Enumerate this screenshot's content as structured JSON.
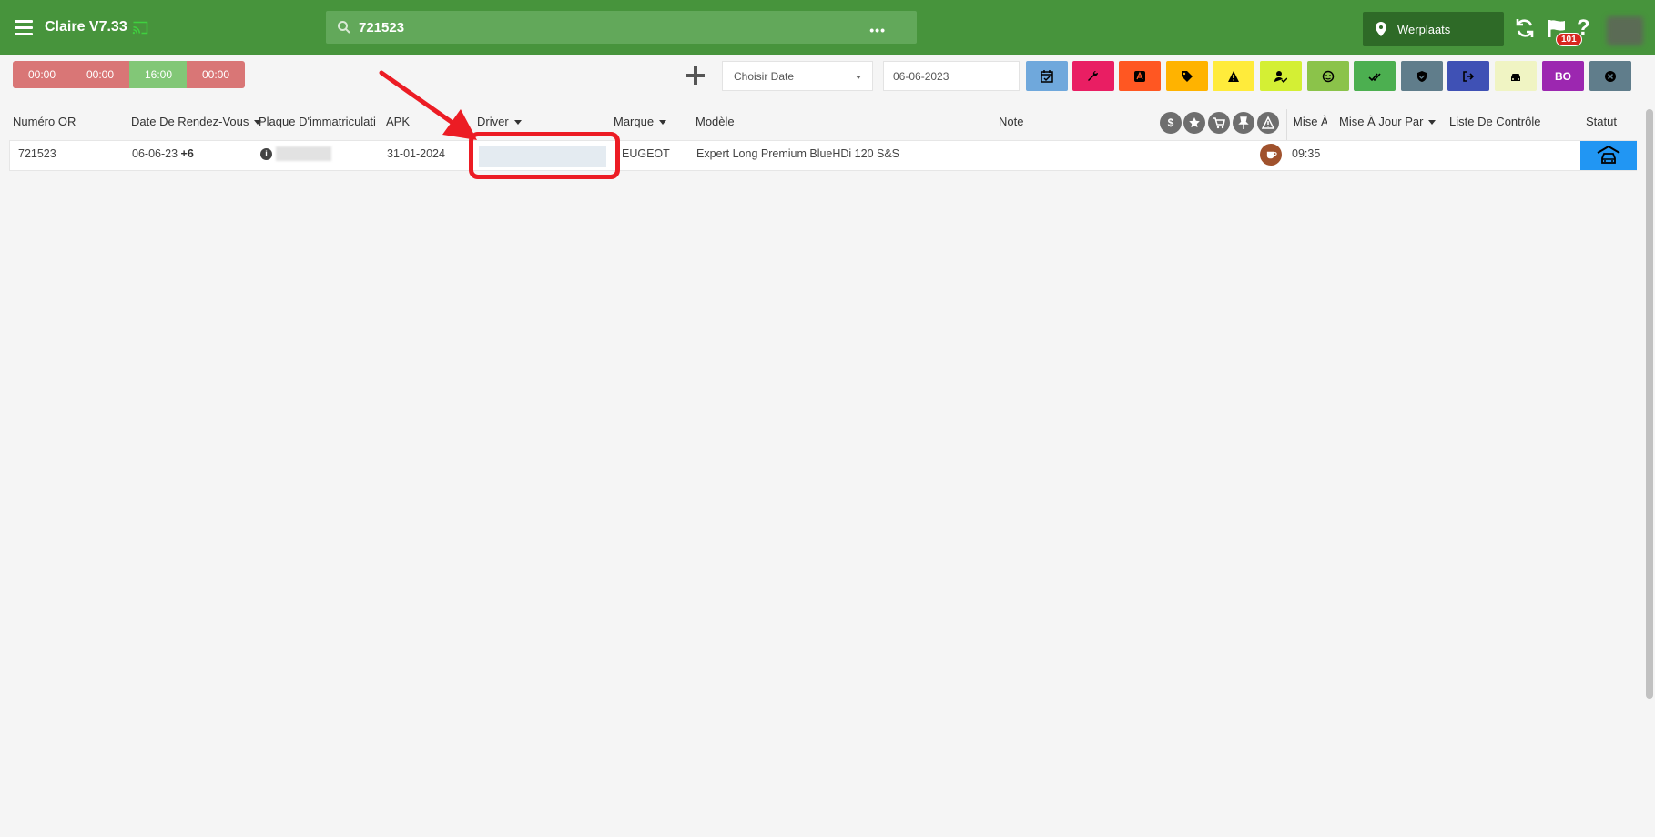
{
  "header": {
    "app_title": "Claire V7.33",
    "search_value": "721523",
    "more_label": "•••",
    "location_label": "Werplaats",
    "notification_count": "101",
    "help_label": "?"
  },
  "toolbar": {
    "timers": [
      "00:00",
      "00:00",
      "16:00",
      "00:00"
    ],
    "date_select_label": "Choisir Date",
    "date_value": "06-06-2023",
    "bo_label": "BO"
  },
  "colors": {
    "header_bg": "#47943c",
    "location_bg": "#2e6a27",
    "status_blue": "#2196f3",
    "highlight_red": "#ec1c24"
  },
  "table": {
    "columns": {
      "numero_or": "Numéro OR",
      "date_rdv": "Date De Rendez-Vous",
      "plaque": "Plaque D'immatriculati",
      "apk": "APK",
      "driver": "Driver",
      "marque": "Marque",
      "modele": "Modèle",
      "note": "Note",
      "mise_a": "Mise À",
      "mise_a_jour_par": "Mise À Jour Par",
      "liste_controle": "Liste De Contrôle",
      "statut": "Statut"
    },
    "rows": [
      {
        "numero_or": "721523",
        "date_rdv": "06-06-23",
        "date_plus": "+6",
        "apk": "31-01-2024",
        "marque": "EUGEOT",
        "modele": "Expert Long Premium BlueHDi 120 S&S",
        "mise_a": "09:35"
      }
    ]
  }
}
